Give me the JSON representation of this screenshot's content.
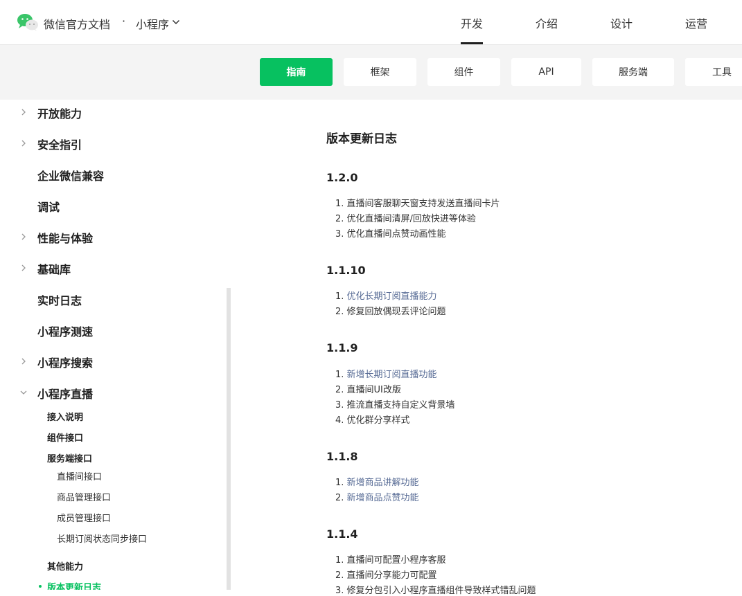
{
  "header": {
    "brand": "微信官方文档",
    "separator": "·",
    "product": "小程序",
    "nav": [
      "开发",
      "介绍",
      "设计",
      "运营"
    ]
  },
  "subtabs": [
    "指南",
    "框架",
    "组件",
    "API",
    "服务端",
    "工具"
  ],
  "sidebar": {
    "top_items": [
      {
        "label": "开放能力",
        "expandable": true
      },
      {
        "label": "安全指引",
        "expandable": true
      },
      {
        "label": "企业微信兼容",
        "expandable": false
      },
      {
        "label": "调试",
        "expandable": false
      },
      {
        "label": "性能与体验",
        "expandable": true
      },
      {
        "label": "基础库",
        "expandable": true
      },
      {
        "label": "实时日志",
        "expandable": false
      },
      {
        "label": "小程序测速",
        "expandable": false
      },
      {
        "label": "小程序搜索",
        "expandable": true
      },
      {
        "label": "小程序直播",
        "expandable": true,
        "expanded": true
      }
    ],
    "live_children": [
      "接入说明",
      "组件接口",
      "服务端接口"
    ],
    "server_children": [
      "直播间接口",
      "商品管理接口",
      "成员管理接口",
      "长期订阅状态同步接口"
    ],
    "other": "其他能力",
    "active": "版本更新日志"
  },
  "content": {
    "title": "版本更新日志",
    "versions": [
      {
        "version": "1.2.0",
        "items": [
          {
            "text": "直播间客服聊天窗支持发送直播间卡片",
            "link": false
          },
          {
            "text": "优化直播间清屏/回放快进等体验",
            "link": false
          },
          {
            "text": "优化直播间点赞动画性能",
            "link": false
          }
        ]
      },
      {
        "version": "1.1.10",
        "items": [
          {
            "text": "优化长期订阅直播能力",
            "link": true
          },
          {
            "text": "修复回放偶现丢评论问题",
            "link": false
          }
        ]
      },
      {
        "version": "1.1.9",
        "items": [
          {
            "text": "新增长期订阅直播功能",
            "link": true
          },
          {
            "text": "直播间UI改版",
            "link": false
          },
          {
            "text": "推流直播支持自定义背景墙",
            "link": false
          },
          {
            "text": "优化群分享样式",
            "link": false
          }
        ]
      },
      {
        "version": "1.1.8",
        "items": [
          {
            "text": "新增商品讲解功能",
            "link": true
          },
          {
            "text": "新增商品点赞功能",
            "link": true
          }
        ]
      },
      {
        "version": "1.1.4",
        "items": [
          {
            "text": "直播间可配置小程序客服",
            "link": false
          },
          {
            "text": "直播间分享能力可配置",
            "link": false
          },
          {
            "text": "修复分包引入小程序直播组件导致样式错乱问题",
            "link": false
          }
        ]
      }
    ]
  },
  "colors": {
    "accent": "#07c160",
    "link": "#576b95"
  },
  "icons": {
    "logo": "wechat-logo-icon",
    "chevron": "chevron-down-icon",
    "arrow": "chevron-right-icon"
  }
}
